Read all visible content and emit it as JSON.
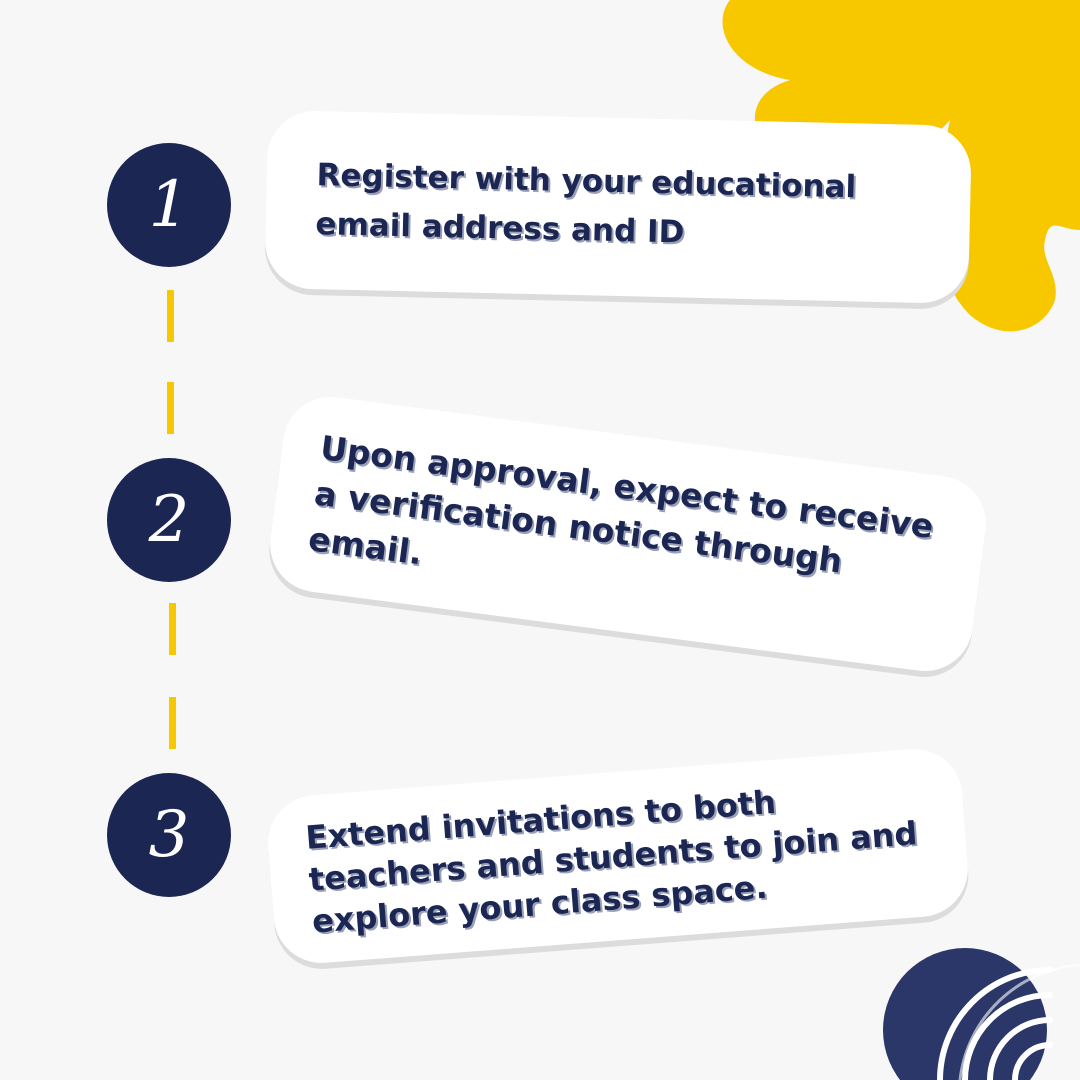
{
  "colors": {
    "background": "#f7f7f7",
    "navy": "#1b2653",
    "accent_yellow": "#f7c800",
    "card": "#ffffff"
  },
  "steps": [
    {
      "number": "1",
      "text": "Register with your educational email address and ID"
    },
    {
      "number": "2",
      "text": "Upon approval, expect to receive a verification notice through email."
    },
    {
      "number": "3",
      "text": "Extend invitations to both teachers and students to join and explore your class space."
    }
  ]
}
